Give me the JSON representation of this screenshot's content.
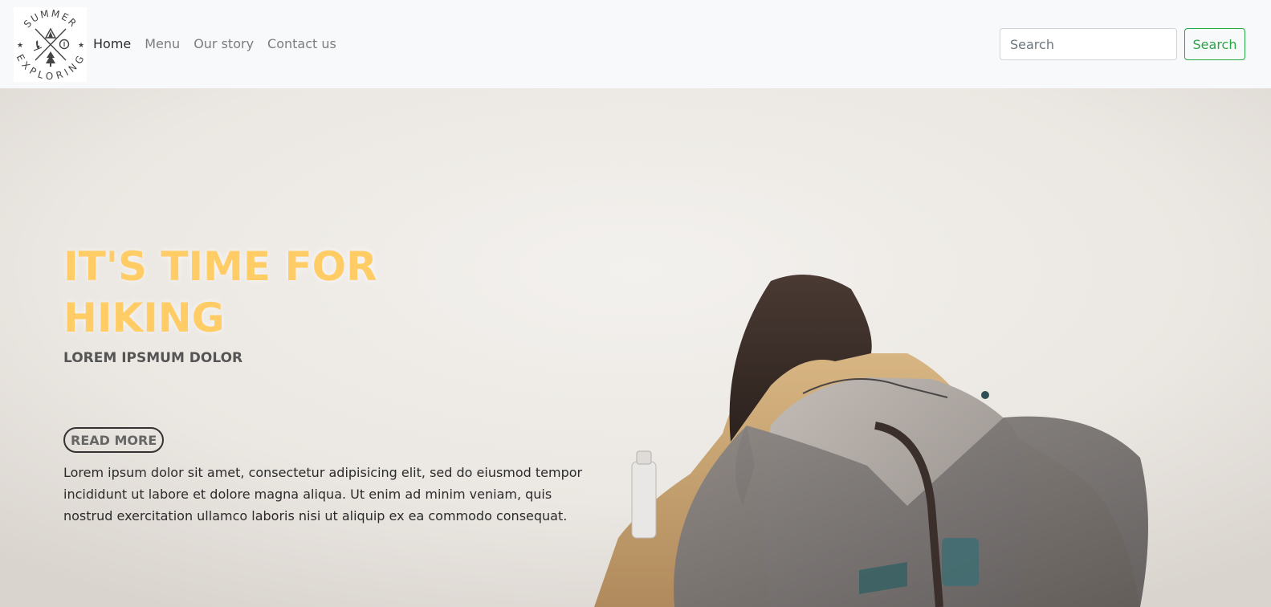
{
  "nav": {
    "logo": {
      "text_top": "SUMMER",
      "text_bottom": "EXPLORING",
      "icons": [
        "tent-icon",
        "campfire-icon",
        "compass-icon",
        "pine-tree-icon",
        "star-icon"
      ]
    },
    "links": [
      {
        "label": "Home",
        "active": true
      },
      {
        "label": "Menu",
        "active": false
      },
      {
        "label": "Our story",
        "active": false
      },
      {
        "label": "Contact us",
        "active": false
      }
    ],
    "search": {
      "placeholder": "Search",
      "value": "",
      "button_label": "Search"
    }
  },
  "hero": {
    "title": "IT'S TIME FOR HIKING",
    "subtitle": "LOREM IPSMUM DOLOR",
    "button_label": "READ MORE",
    "paragraph": "Lorem ipsum dolor sit amet, consectetur adipisicing elit, sed do eiusmod tempor incididunt ut labore et dolore magna aliqua. Ut enim ad minim veniam, quis nostrud exercitation ullamco laboris nisi ut aliquip ex ea commodo consequat."
  },
  "colors": {
    "navbar_bg": "#f8f9fa",
    "accent_green": "#28a745",
    "title_yellow": "#ffcc66",
    "nav_active": "#2a2d30",
    "nav_muted": "#7a7d80"
  }
}
